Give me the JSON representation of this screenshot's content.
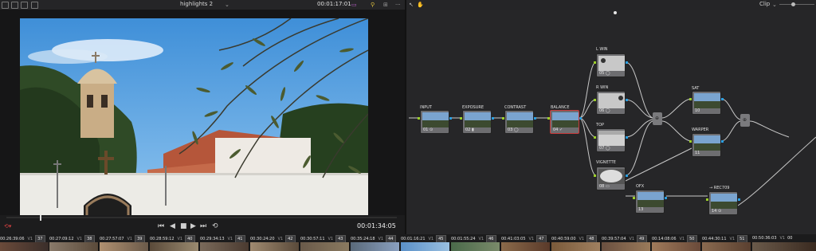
{
  "toolbar": {
    "title": "highlights 2",
    "timecode": "00:01:17:01",
    "mode": "Clip"
  },
  "viewer": {
    "timecode": "00:01:34:05",
    "controls": [
      "⏮",
      "◀",
      "■",
      "▶",
      "⏭",
      "⟲"
    ]
  },
  "nodes": [
    {
      "name": "INPUT",
      "label": "01 ⊙"
    },
    {
      "name": "EXPOSURE",
      "label": "02 ▮"
    },
    {
      "name": "CONTRAST",
      "label": "03 ◯"
    },
    {
      "name": "BALANCE",
      "label": "04 ✓"
    },
    {
      "name": "L WIN",
      "label": "05 ◯"
    },
    {
      "name": "R WIN",
      "label": "06 ◯"
    },
    {
      "name": "TOP",
      "label": "07 ◯"
    },
    {
      "name": "VIGNETTE",
      "label": "08 ▭"
    },
    {
      "name": "SAT",
      "label": "10"
    },
    {
      "name": "WARPER",
      "label": "11"
    },
    {
      "name": "OFX",
      "label": "13"
    },
    {
      "name": "→ REC709",
      "label": "14 ⊙"
    }
  ],
  "timeline": {
    "clips": [
      {
        "tc": "00:26:39:06",
        "track": "V1",
        "num": "36"
      },
      {
        "tc": "00:27:09:12",
        "track": "V1",
        "num": "37"
      },
      {
        "tc": "00:27:57:07",
        "track": "V1",
        "num": "38"
      },
      {
        "tc": "00:28:59:12",
        "track": "V1",
        "num": "39"
      },
      {
        "tc": "00:29:34:13",
        "track": "V1",
        "num": "40"
      },
      {
        "tc": "00:30:24:20",
        "track": "V1",
        "num": "41"
      },
      {
        "tc": "00:30:57:11",
        "track": "V1",
        "num": "42"
      },
      {
        "tc": "00:35:24:18",
        "track": "V1",
        "num": "43"
      },
      {
        "tc": "00:01:16:21",
        "track": "V1",
        "num": "44"
      },
      {
        "tc": "00:01:55:24",
        "track": "V1",
        "num": "45"
      },
      {
        "tc": "00:41:03:05",
        "track": "V1",
        "num": "46"
      },
      {
        "tc": "00:40:59:00",
        "track": "V1",
        "num": "47"
      },
      {
        "tc": "00:39:57:04",
        "track": "V1",
        "num": "48"
      },
      {
        "tc": "00:14:08:06",
        "track": "V1",
        "num": "49"
      },
      {
        "tc": "00:44:30:11",
        "track": "V1",
        "num": "50"
      },
      {
        "tc": "00:50:36:03",
        "track": "V1",
        "num": "51"
      },
      {
        "tc": "00",
        "track": "",
        "num": ""
      }
    ]
  },
  "colors": {
    "accent_select": "#c83a3a",
    "port_in": "#9ccf2a",
    "port_out": "#2a9ee0"
  }
}
